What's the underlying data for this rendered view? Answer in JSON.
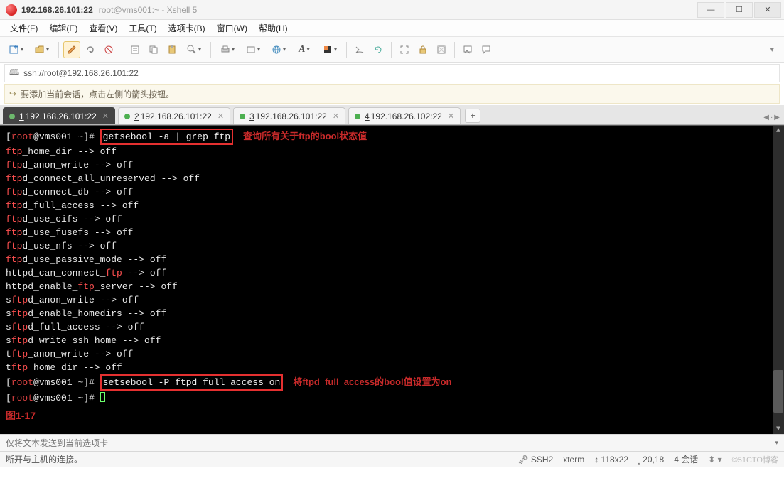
{
  "window": {
    "title_main": "192.168.26.101:22",
    "title_sub": "root@vms001:~ - Xshell 5"
  },
  "menu": {
    "file": "文件(F)",
    "edit": "编辑(E)",
    "view": "查看(V)",
    "tools": "工具(T)",
    "tab": "选项卡(B)",
    "window": "窗口(W)",
    "help": "帮助(H)"
  },
  "toolbar_icons": [
    "new-session-icon",
    "open-folder-icon",
    "edit-pencil-icon",
    "reconnect-icon",
    "disconnect-icon",
    "properties-icon",
    "copy-icon",
    "paste-icon",
    "find-icon",
    "print-icon",
    "font-larger-icon",
    "globe-icon",
    "font-style-icon",
    "color-scheme-icon",
    "scroll-icon",
    "refresh-icon",
    "fullscreen-icon",
    "lock-icon",
    "transparency-icon",
    "compose-icon",
    "chat-icon"
  ],
  "address": {
    "url": "ssh://root@192.168.26.101:22"
  },
  "tipbar": {
    "text": "要添加当前会话，点击左侧的箭头按钮。"
  },
  "tabs": [
    {
      "num": "1",
      "label": " 192.168.26.101:22",
      "active": true
    },
    {
      "num": "2",
      "label": " 192.168.26.101:22",
      "active": false
    },
    {
      "num": "3",
      "label": " 192.168.26.101:22",
      "active": false
    },
    {
      "num": "4",
      "label": " 192.168.26.102:22",
      "active": false
    }
  ],
  "terminal": {
    "prompt_user": "root",
    "prompt_at": "@",
    "prompt_host": "vms001",
    "prompt_dir": " ~",
    "prompt_close": "]# ",
    "cmd1": "getsebool -a | grep ftp",
    "annot1": "查询所有关于ftp的bool状态值",
    "bools": [
      {
        "key": "ftp",
        "rest": "_home_dir --> off"
      },
      {
        "key": "ftp",
        "rest": "d_anon_write --> off"
      },
      {
        "key": "ftp",
        "rest": "d_connect_all_unreserved --> off"
      },
      {
        "key": "ftp",
        "rest": "d_connect_db --> off"
      },
      {
        "key": "ftp",
        "rest": "d_full_access --> off"
      },
      {
        "key": "ftp",
        "rest": "d_use_cifs --> off"
      },
      {
        "key": "ftp",
        "rest": "d_use_fusefs --> off"
      },
      {
        "key": "ftp",
        "rest": "d_use_nfs --> off"
      },
      {
        "key": "ftp",
        "rest": "d_use_passive_mode --> off"
      },
      {
        "key": "",
        "rest": "httpd_can_connect_",
        "key2": "ftp",
        "rest2": " --> off"
      },
      {
        "key": "",
        "rest": "httpd_enable_",
        "key2": "ftp",
        "rest2": "_server --> off"
      },
      {
        "key": "",
        "rest": "s",
        "key2": "ftp",
        "rest2": "d_anon_write --> off"
      },
      {
        "key": "",
        "rest": "s",
        "key2": "ftp",
        "rest2": "d_enable_homedirs --> off"
      },
      {
        "key": "",
        "rest": "s",
        "key2": "ftp",
        "rest2": "d_full_access --> off"
      },
      {
        "key": "",
        "rest": "s",
        "key2": "ftp",
        "rest2": "d_write_ssh_home --> off"
      },
      {
        "key": "",
        "rest": "t",
        "key2": "ftp",
        "rest2": "_anon_write --> off"
      },
      {
        "key": "",
        "rest": "t",
        "key2": "ftp",
        "rest2": "_home_dir --> off"
      }
    ],
    "cmd2": "setsebool -P ftpd_full_access on",
    "annot2": "将ftpd_full_access的bool值设置为on",
    "figlabel": "图1-17"
  },
  "sendbar": {
    "text": "仅将文本发送到当前选项卡"
  },
  "status": {
    "left": "断开与主机的连接。",
    "ssh": "SSH2",
    "term": "xterm",
    "size": "118x22",
    "cursor": "20,18",
    "sessions": "4 会话",
    "watermark": "©51CTO博客"
  }
}
